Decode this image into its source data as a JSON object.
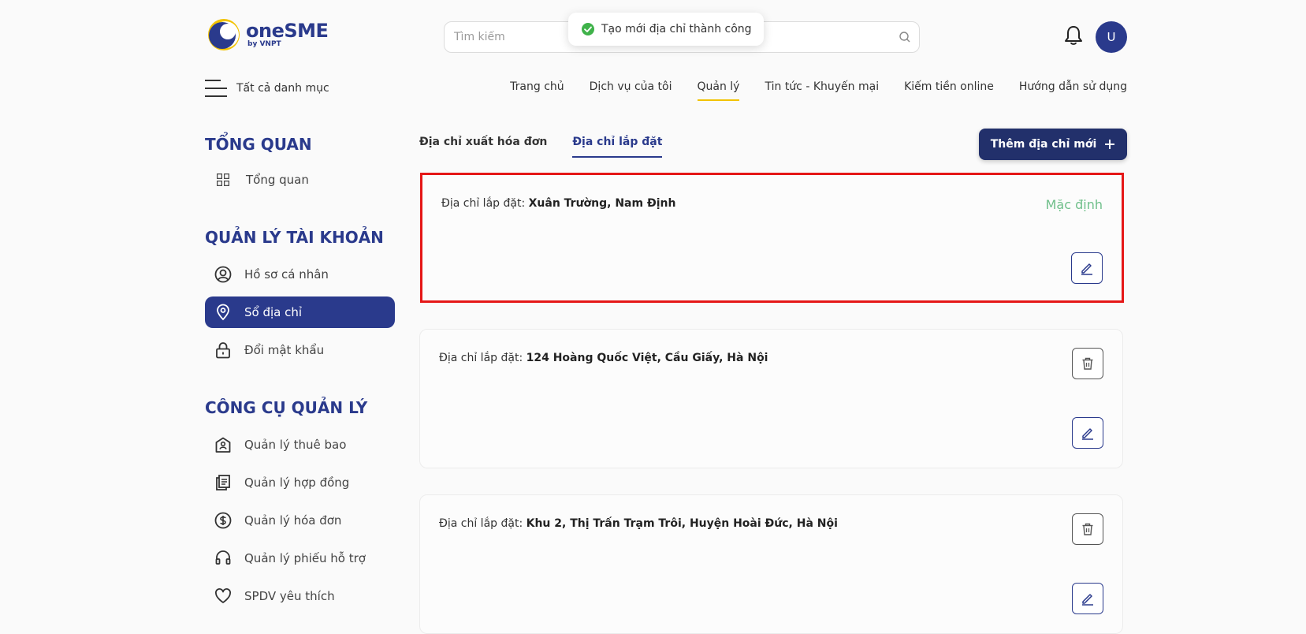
{
  "brand": {
    "name": "oneSME",
    "sub": "by VNPT"
  },
  "search": {
    "placeholder": "Tìm kiếm"
  },
  "toast": {
    "message": "Tạo mới địa chỉ thành công"
  },
  "user": {
    "initial": "U"
  },
  "menu": {
    "label": "Tất cả danh mục"
  },
  "nav": [
    {
      "label": "Trang chủ"
    },
    {
      "label": "Dịch vụ của tôi"
    },
    {
      "label": "Quản lý"
    },
    {
      "label": "Tin tức - Khuyến mại"
    },
    {
      "label": "Kiếm tiền online"
    },
    {
      "label": "Hướng dẫn sử dụng"
    }
  ],
  "sidebar": {
    "overview_title": "TỔNG QUAN",
    "overview_items": [
      {
        "label": "Tổng quan",
        "icon": "grid-icon"
      }
    ],
    "account_title": "QUẢN LÝ TÀI KHOẢN",
    "account_items": [
      {
        "label": "Hồ sơ cá nhân",
        "icon": "user-circle-icon"
      },
      {
        "label": "Sổ địa chỉ",
        "icon": "location-pin-icon"
      },
      {
        "label": "Đổi mật khẩu",
        "icon": "lock-icon"
      }
    ],
    "tools_title": "CÔNG CỤ QUẢN LÝ",
    "tools_items": [
      {
        "label": "Quản lý thuê bao",
        "icon": "subscription-icon"
      },
      {
        "label": "Quản lý hợp đồng",
        "icon": "contract-icon"
      },
      {
        "label": "Quản lý hóa đơn",
        "icon": "dollar-circle-icon"
      },
      {
        "label": "Quản lý phiếu hỗ trợ",
        "icon": "headset-icon"
      },
      {
        "label": "SPDV yêu thích",
        "icon": "heart-icon"
      }
    ]
  },
  "tabs": [
    {
      "label": "Địa chỉ xuất hóa đơn"
    },
    {
      "label": "Địa chỉ lắp đặt"
    }
  ],
  "add_button": {
    "label": "Thêm địa chỉ mới"
  },
  "addresses": [
    {
      "prefix": "Địa chỉ lắp đặt:",
      "value": "Xuân Trường, Nam Định",
      "default_label": "Mặc định"
    },
    {
      "prefix": "Địa chỉ lắp đặt:",
      "value": "124 Hoàng Quốc Việt, Cầu Giấy, Hà Nội"
    },
    {
      "prefix": "Địa chỉ lắp đặt:",
      "value": "Khu 2, Thị Trấn Trạm Trôi, Huyện Hoài Đức, Hà Nội"
    }
  ],
  "colors": {
    "primary": "#2a3a8c",
    "nav_underline": "#f2c200",
    "default_badge": "#6fbf8a",
    "highlight_border": "#e51717",
    "toast_success": "#3fb24a"
  }
}
